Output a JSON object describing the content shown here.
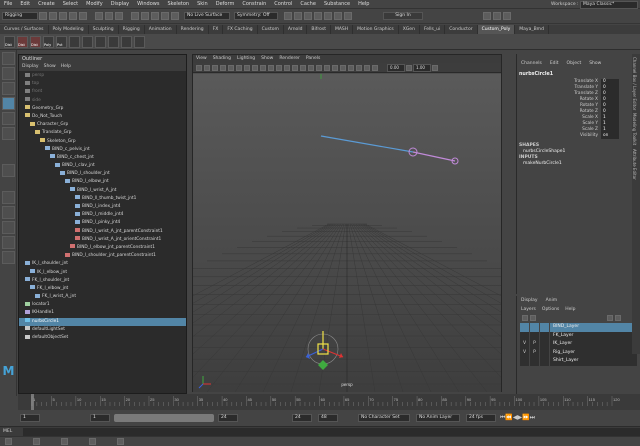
{
  "menubar": [
    "File",
    "Edit",
    "Create",
    "Select",
    "Modify",
    "Display",
    "Windows",
    "Skeleton",
    "Skin",
    "Deform",
    "Constrain",
    "Control",
    "Cache",
    "Substance",
    "Help"
  ],
  "workspace": {
    "label": "Workspace :",
    "value": "Maya Classic*"
  },
  "status": {
    "menuset": "Rigging",
    "live_surface": "No Live Surface",
    "symmetry": "Symmetry: Off",
    "signin": "Sign In"
  },
  "shelf_tabs": [
    "Curves / Surfaces",
    "Poly Modeling",
    "Sculpting",
    "Rigging",
    "Animation",
    "Rendering",
    "FX",
    "FX Caching",
    "Custom",
    "Arnold",
    "Bifrost",
    "MASH",
    "Motion Graphics",
    "XGen",
    "Fells_ui",
    "Conductor",
    "Custom_Poly",
    "Maya_Bmd"
  ],
  "shelf_active": "Custom_Poly",
  "shelf_labels": [
    "Dist",
    "Dist",
    "Dist",
    "Poly",
    "Pvt"
  ],
  "outliner": {
    "title": "Outliner",
    "menu": [
      "Display",
      "Show",
      "Help"
    ],
    "items": [
      {
        "label": "persp",
        "indent": 0,
        "kind": "cam",
        "dim": true
      },
      {
        "label": "top",
        "indent": 0,
        "kind": "cam",
        "dim": true
      },
      {
        "label": "front",
        "indent": 0,
        "kind": "cam",
        "dim": true
      },
      {
        "label": "side",
        "indent": 0,
        "kind": "cam",
        "dim": true
      },
      {
        "label": "Geometry_Grp",
        "indent": 0,
        "kind": "grp"
      },
      {
        "label": "Do_Not_Touch",
        "indent": 0,
        "kind": "grp"
      },
      {
        "label": "Character_Grp",
        "indent": 1,
        "kind": "grp"
      },
      {
        "label": "Translate_Grp",
        "indent": 2,
        "kind": "grp"
      },
      {
        "label": "Skeleton_Grp",
        "indent": 3,
        "kind": "grp"
      },
      {
        "label": "BIND_c_pelvis_jnt",
        "indent": 4,
        "kind": "jnt"
      },
      {
        "label": "BIND_c_chest_jnt",
        "indent": 5,
        "kind": "jnt"
      },
      {
        "label": "BIND_l_clav_jnt",
        "indent": 6,
        "kind": "jnt"
      },
      {
        "label": "BIND_l_shoulder_jnt",
        "indent": 7,
        "kind": "jnt"
      },
      {
        "label": "BIND_l_elbow_jnt",
        "indent": 8,
        "kind": "jnt"
      },
      {
        "label": "BIND_l_wrist_A_jnt",
        "indent": 9,
        "kind": "jnt"
      },
      {
        "label": "BIND_ll_thumb_twist_jnt1",
        "indent": 10,
        "kind": "jnt"
      },
      {
        "label": "BIND_l_index_jnt4",
        "indent": 10,
        "kind": "jnt"
      },
      {
        "label": "BIND_l_middle_jnt4",
        "indent": 10,
        "kind": "jnt"
      },
      {
        "label": "BIND_l_pinky_jnt4",
        "indent": 10,
        "kind": "jnt"
      },
      {
        "label": "BIND_l_wrist_A_jnt_parentConstraint1",
        "indent": 10,
        "kind": "con"
      },
      {
        "label": "BIND_l_wrist_A_jnt_orientConstraint1",
        "indent": 10,
        "kind": "con"
      },
      {
        "label": "BIND_l_elbow_jnt_parentConstraint1",
        "indent": 9,
        "kind": "con"
      },
      {
        "label": "BIND_l_shoulder_jnt_parentConstraint1",
        "indent": 8,
        "kind": "con"
      },
      {
        "label": "IK_l_shoulder_jnt",
        "indent": 0,
        "kind": "jnt"
      },
      {
        "label": "IK_l_elbow_jnt",
        "indent": 1,
        "kind": "jnt"
      },
      {
        "label": "FK_l_shoulder_jnt",
        "indent": 0,
        "kind": "jnt"
      },
      {
        "label": "FK_l_elbow_jnt",
        "indent": 1,
        "kind": "jnt"
      },
      {
        "label": "FK_l_wrist_A_jnt",
        "indent": 2,
        "kind": "jnt"
      },
      {
        "label": "locator1",
        "indent": 0,
        "kind": "loc"
      },
      {
        "label": "IKHandle1",
        "indent": 0,
        "kind": "ik"
      },
      {
        "label": "nurbsCircle1",
        "indent": 0,
        "kind": "crv",
        "selected": true
      },
      {
        "label": "defaultLightSet",
        "indent": 0,
        "kind": "set"
      },
      {
        "label": "defaultObjectSet",
        "indent": 0,
        "kind": "set"
      }
    ]
  },
  "viewport": {
    "menu": [
      "View",
      "Shading",
      "Lighting",
      "Show",
      "Renderer",
      "Panels"
    ],
    "camera": "persp",
    "gamma_a": "0.00",
    "gamma_b": "1.00"
  },
  "channel_box": {
    "menu": [
      "Channels",
      "Edit",
      "Object",
      "Show"
    ],
    "object": "nurbsCircle1",
    "attrs": [
      {
        "name": "Translate X",
        "value": "0"
      },
      {
        "name": "Translate Y",
        "value": "0"
      },
      {
        "name": "Translate Z",
        "value": "0"
      },
      {
        "name": "Rotate X",
        "value": "0"
      },
      {
        "name": "Rotate Y",
        "value": "0"
      },
      {
        "name": "Rotate Z",
        "value": "0"
      },
      {
        "name": "Scale X",
        "value": "1"
      },
      {
        "name": "Scale Y",
        "value": "1"
      },
      {
        "name": "Scale Z",
        "value": "1"
      },
      {
        "name": "Visibility",
        "value": "on"
      }
    ],
    "shapes_label": "SHAPES",
    "shape": "nurbsCircleShape1",
    "inputs_label": "INPUTS",
    "input": "makeNurbCircle1"
  },
  "layers": {
    "tabs": [
      "Display",
      "Anim"
    ],
    "menu": [
      "Layers",
      "Options",
      "Help"
    ],
    "rows": [
      {
        "v": "",
        "p": "",
        "name": "BIND_Layer",
        "selected": true
      },
      {
        "v": "",
        "p": "",
        "name": "FK_Layer"
      },
      {
        "v": "V",
        "p": "P",
        "name": "IK_Layer"
      },
      {
        "v": "V",
        "p": "P",
        "name": "Rig_Layer"
      },
      {
        "v": "",
        "p": "",
        "name": "Shirt_Layer"
      }
    ]
  },
  "right_tabs": [
    "Channel Box / Layer Editor",
    "Modeling Toolkit",
    "Attribute Editor"
  ],
  "timeline": {
    "ticks": [
      "1",
      "5",
      "10",
      "15",
      "20",
      "25",
      "30",
      "35",
      "40",
      "45",
      "50",
      "55",
      "60",
      "65",
      "70",
      "75",
      "80",
      "85",
      "90",
      "95",
      "100",
      "105",
      "110",
      "115",
      "120"
    ],
    "current": "1"
  },
  "range": {
    "start": "1",
    "start2": "1",
    "end": "24",
    "end2": "24",
    "max": "48",
    "character_set": "No Character Set",
    "anim_layer": "No Anim Layer",
    "fps": "24 fps"
  },
  "mel": {
    "label": "MEL"
  },
  "colors": {
    "selection": "#5285a6",
    "accent_blue": "#5b9bd5",
    "joint_pink": "#c08ad8"
  }
}
